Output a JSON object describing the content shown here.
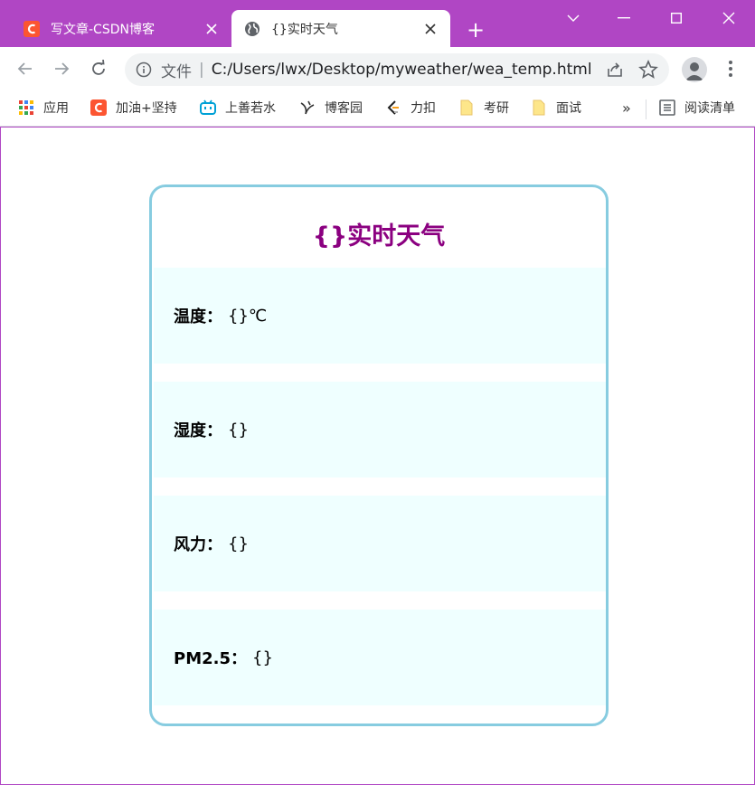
{
  "browser": {
    "tabs": [
      {
        "title": "写文章-CSDN博客",
        "close_icon": "close-icon"
      },
      {
        "title": "{}实时天气",
        "close_icon": "close-icon"
      }
    ],
    "new_tab_label": "+",
    "address": {
      "scheme_label": "文件",
      "separator": "|",
      "url": "C:/Users/lwx/Desktop/myweather/wea_temp.html"
    },
    "bookmarks": [
      {
        "label": "应用",
        "icon": "apps-grid-icon"
      },
      {
        "label": "加油+坚持",
        "icon": "csdn-icon"
      },
      {
        "label": "上善若水",
        "icon": "bilibili-icon"
      },
      {
        "label": "博客园",
        "icon": "cnblogs-icon"
      },
      {
        "label": "力扣",
        "icon": "leetcode-icon"
      },
      {
        "label": "考研",
        "icon": "folder-icon"
      },
      {
        "label": "面试",
        "icon": "folder-icon"
      }
    ],
    "more_bookmarks": "»",
    "reading_list": "阅读清单",
    "colors": {
      "frame": "#b046c4",
      "omnibox": "#f1f3f4"
    }
  },
  "page": {
    "title": "{}实时天气",
    "rows": [
      {
        "label": "温度：",
        "value": "{}℃"
      },
      {
        "label": "湿度：",
        "value": "{}"
      },
      {
        "label": "风力：",
        "value": "{}"
      },
      {
        "label": "PM2.5：",
        "value": "{}"
      }
    ],
    "colors": {
      "title": "#8b0080",
      "card_border": "#87cce0",
      "row_bg": "#efffff"
    }
  }
}
